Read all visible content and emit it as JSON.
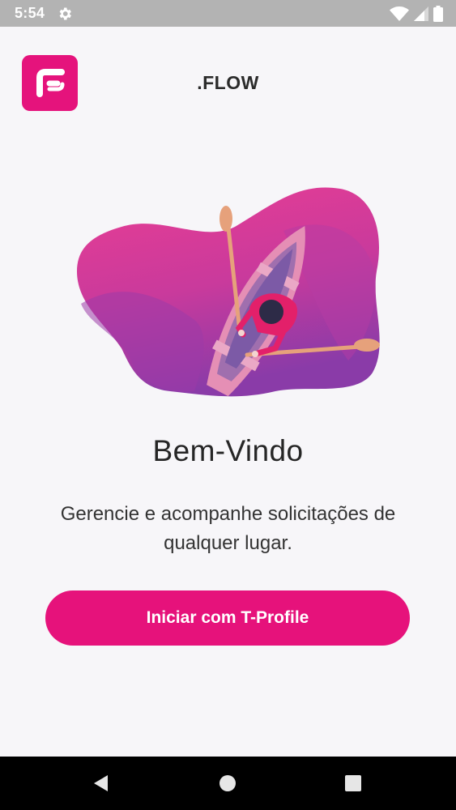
{
  "status_bar": {
    "time": "5:54",
    "icons": [
      "gear-icon",
      "wifi-icon",
      "cell-signal-icon",
      "battery-icon"
    ]
  },
  "header": {
    "logo_icon": "flow-logo",
    "title": ".FLOW"
  },
  "hero": {
    "illustration": "person-rowing-boat-illustration"
  },
  "welcome": {
    "title": "Bem-Vindo",
    "subtitle": "Gerencie e acompanhe solicitações de qualquer lugar."
  },
  "actions": {
    "start_label": "Iniciar com T-Profile"
  },
  "nav_bar": {
    "icons": [
      "back-icon",
      "home-icon",
      "recents-icon"
    ]
  },
  "colors": {
    "accent": "#e6127b",
    "background": "#f7f6f9",
    "status_bar": "#b3b3b3",
    "nav_bar": "#000000"
  }
}
